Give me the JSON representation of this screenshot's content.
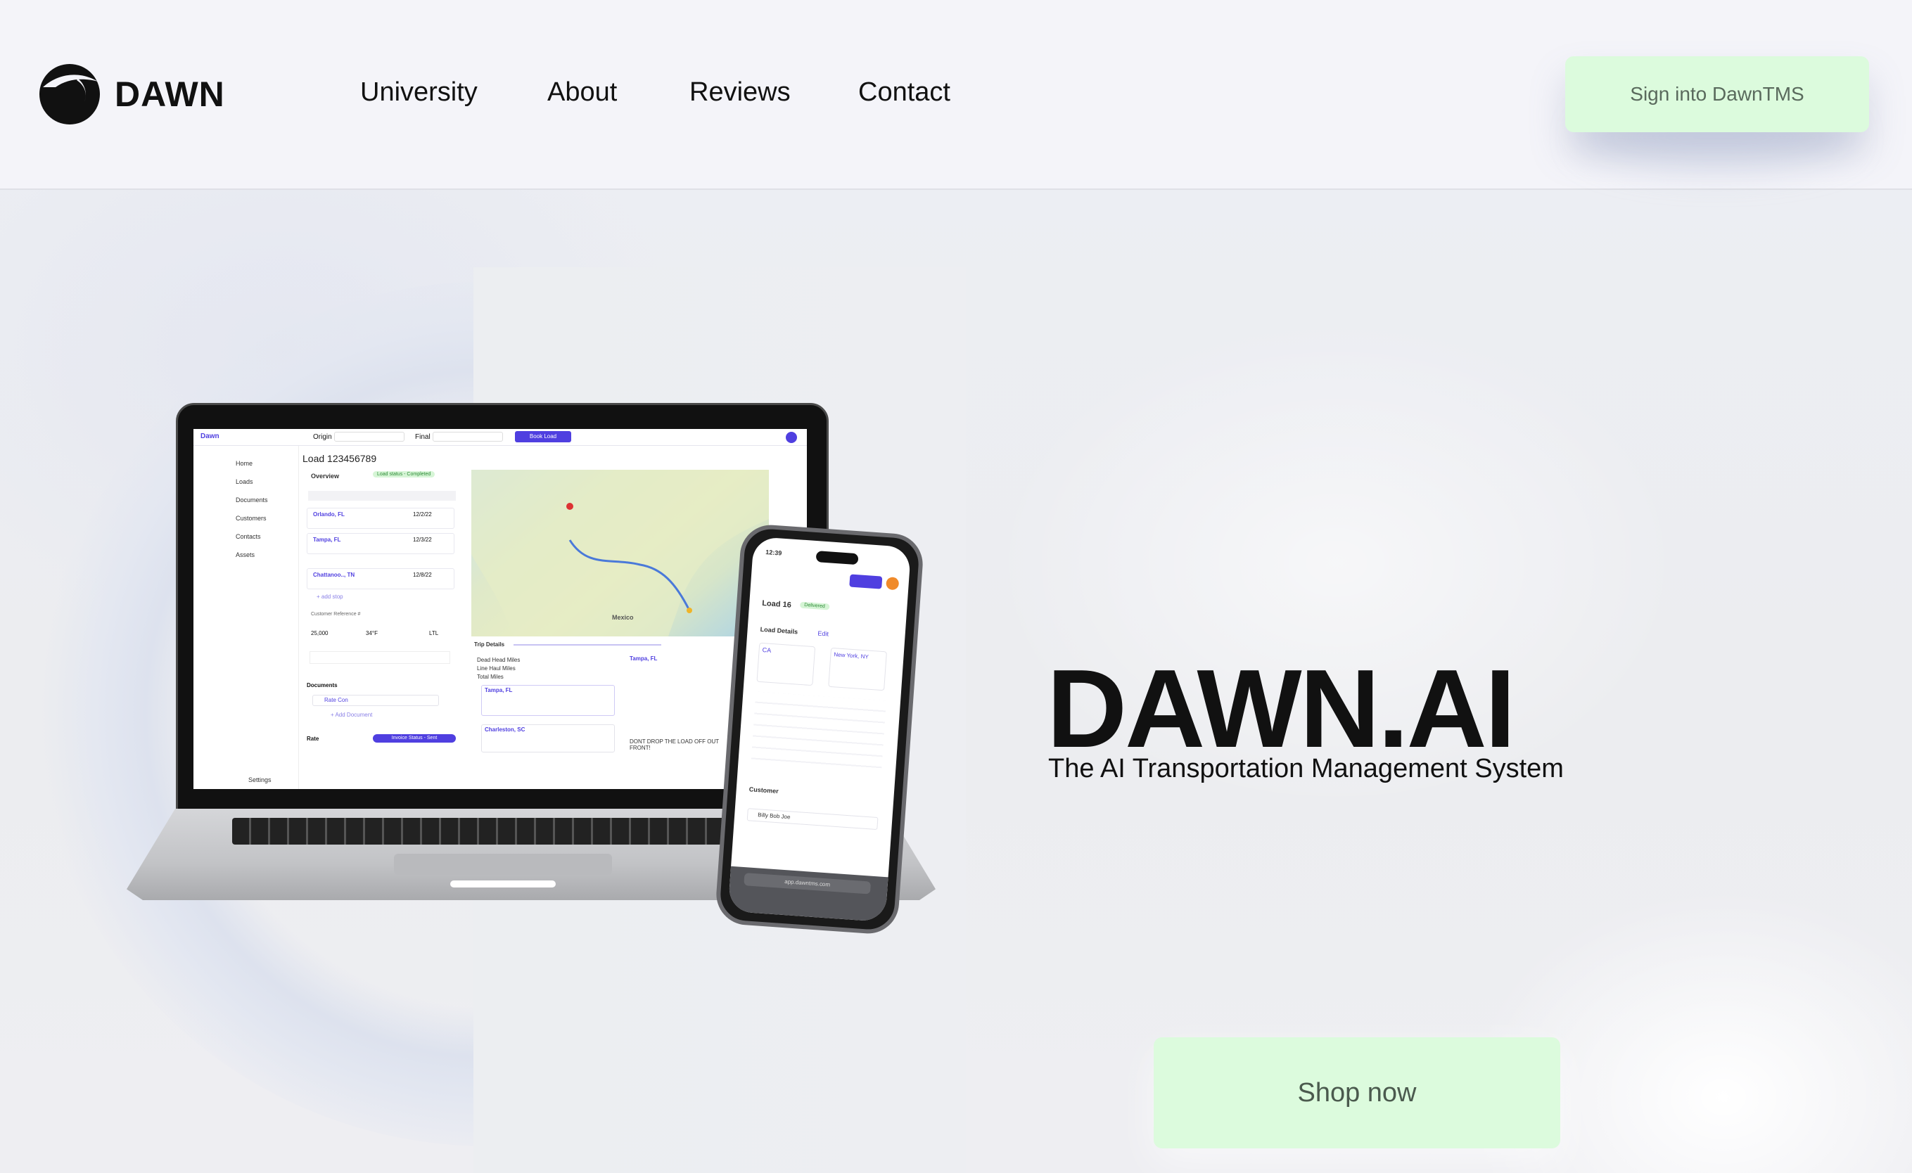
{
  "header": {
    "logo_text": "DAWN",
    "nav": [
      {
        "label": "University"
      },
      {
        "label": "About"
      },
      {
        "label": "Reviews"
      },
      {
        "label": "Contact"
      }
    ],
    "signin_label": "Sign  into DawnTMS"
  },
  "hero": {
    "title": "DAWN.AI",
    "subtitle": "The AI Transportation Management System",
    "cta_label": "Shop now"
  },
  "laptop_app": {
    "brand": "Dawn",
    "origin_label": "Origin",
    "final_label": "Final",
    "book_button": "Book Load",
    "load_title": "Load 123456789",
    "sidebar": [
      "Home",
      "Loads",
      "Documents",
      "Customers",
      "Contacts",
      "Assets"
    ],
    "settings": "Settings",
    "overview": "Overview",
    "status_badge": "Load status - Completed",
    "stops": [
      {
        "city": "Orlando, FL",
        "date": "12/2/22"
      },
      {
        "city": "Tampa, FL",
        "date": "12/3/22"
      },
      {
        "city": "Chattanoo.., TN",
        "date": "12/8/22"
      }
    ],
    "add_stop": "+ add stop",
    "customer_ref": "Customer Reference #",
    "weight": "25,000",
    "temp": "34°F",
    "service": "LTL",
    "documents": "Documents",
    "rate_con": "Rate Con",
    "add_document": "+ Add Document",
    "rate": "Rate",
    "invoice_status": "Invoice Status - Sent",
    "trip_details": "Trip Details",
    "trip_rows": [
      "Dead Head Miles",
      "Line Haul Miles",
      "Total Miles"
    ],
    "trip_stop1": "Tampa, FL",
    "trip_stop2": "Charleston, SC",
    "detail_city": "Tampa, FL",
    "detail_note": "DONT DROP THE LOAD OFF OUT FRONT!",
    "map_label": "Mexico"
  },
  "phone_app": {
    "time": "12:39",
    "load": "Load 16",
    "badge": "Delivered",
    "load_details": "Load Details",
    "edit": "Edit",
    "origin": "CA",
    "destination": "New York, NY",
    "customer": "Customer",
    "customer_name": "Billy Bob Joe",
    "url": "app.dawntms.com"
  },
  "colors": {
    "accent_green": "#dcfbdd",
    "app_purple": "#4f3fe0"
  }
}
